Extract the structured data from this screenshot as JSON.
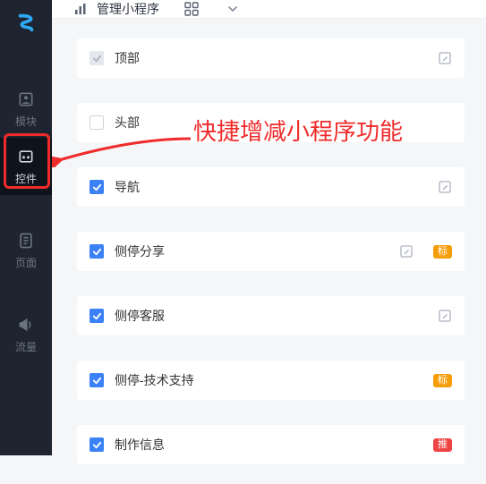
{
  "logo_color": "#2EA8F3",
  "sidebar": {
    "items": [
      {
        "label": "模块",
        "key": "modules"
      },
      {
        "label": "控件",
        "key": "widgets"
      },
      {
        "label": "页面",
        "key": "pages"
      },
      {
        "label": "流量",
        "key": "traffic"
      }
    ],
    "active_index": 1
  },
  "topbar": {
    "title": "管理小程序"
  },
  "rows": [
    {
      "label": "顶部",
      "checked": true,
      "locked": true,
      "edit": true,
      "badge": null
    },
    {
      "label": "头部",
      "checked": false,
      "locked": false,
      "edit": false,
      "badge": null
    },
    {
      "label": "导航",
      "checked": true,
      "locked": false,
      "edit": true,
      "badge": null
    },
    {
      "label": "侧停分享",
      "checked": true,
      "locked": false,
      "edit": true,
      "badge": {
        "text": "标",
        "color": "orange"
      }
    },
    {
      "label": "侧停客服",
      "checked": true,
      "locked": false,
      "edit": true,
      "badge": null
    },
    {
      "label": "侧停-技术支持",
      "checked": true,
      "locked": false,
      "edit": false,
      "badge": {
        "text": "标",
        "color": "orange"
      }
    },
    {
      "label": "制作信息",
      "checked": true,
      "locked": false,
      "edit": false,
      "badge": {
        "text": "推",
        "color": "red"
      }
    }
  ],
  "annotation": {
    "text": "快捷增减小程序功能"
  }
}
